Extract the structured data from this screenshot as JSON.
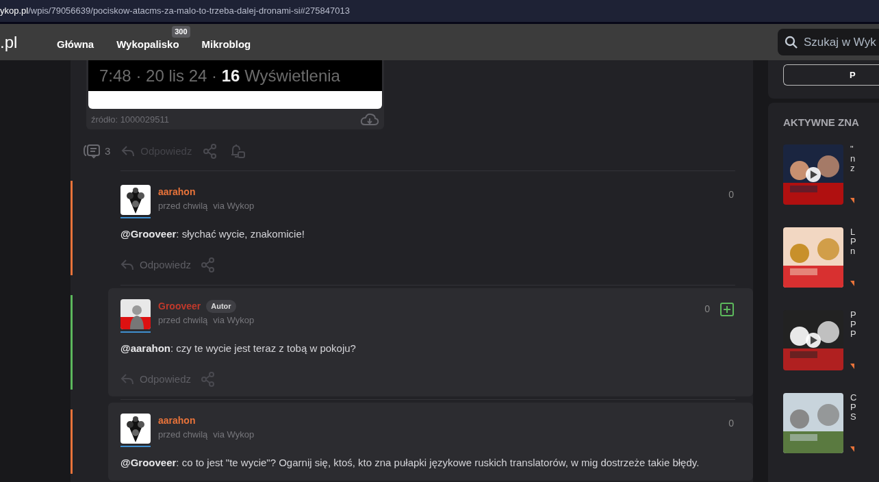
{
  "address_bar": {
    "host": "ykop.pl",
    "path": "/wpis/79056639/pociskow-atacms-za-malo-to-trzeba-dalej-dronami-si#275847013"
  },
  "nav": {
    "logo": ".pl",
    "items": [
      {
        "label": "Główna"
      },
      {
        "label": "Wykopalisko",
        "badge": "300"
      },
      {
        "label": "Mikroblog"
      }
    ],
    "search": {
      "placeholder": "Szukaj w Wyk"
    }
  },
  "post": {
    "image_caption": "7:48 · 20 lis 24 · **16** Wyświetlenia",
    "source": "źródło: 1000029511",
    "comment_count": "3",
    "reply_label": "Odpowiedz"
  },
  "comments": [
    {
      "kind": "reply",
      "author": "aarahon",
      "highlighted": false,
      "time": "przed chwilą",
      "via": "via Wykop",
      "text": "**@Grooveer**: słychać wycie, znakomicie!",
      "score": "0",
      "vote_button": false,
      "reply_label": "Odpowiedz"
    },
    {
      "kind": "author",
      "author": "Grooveer",
      "highlighted": true,
      "badge": "Autor",
      "time": "przed chwilą",
      "via": "via Wykop",
      "text": "**@aarahon**: czy te wycie jest teraz z tobą w pokoju?",
      "score": "0",
      "vote_button": true,
      "reply_label": "Odpowiedz"
    },
    {
      "kind": "reply",
      "author": "aarahon",
      "highlighted": true,
      "time": "przed chwilą",
      "via": "via Wykop",
      "text": "**@Grooveer**: co to jest \"te wycie\"? Ogarnij się, ktoś, kto zna pułapki językowe ruskich translatorów, w mig dostrzeże takie błędy.",
      "score": "0",
      "vote_button": false
    }
  ],
  "sidebar": {
    "button": "P",
    "section_title": "AKTYWNE ZNA",
    "items": [
      {
        "lines": [
          "\"",
          "n",
          "z"
        ],
        "video": true
      },
      {
        "lines": [
          "L",
          "P",
          "n"
        ],
        "video": false
      },
      {
        "lines": [
          "P",
          "P",
          "P"
        ],
        "video": true
      },
      {
        "lines": [
          "C",
          "P",
          "S"
        ],
        "video": false
      }
    ]
  }
}
